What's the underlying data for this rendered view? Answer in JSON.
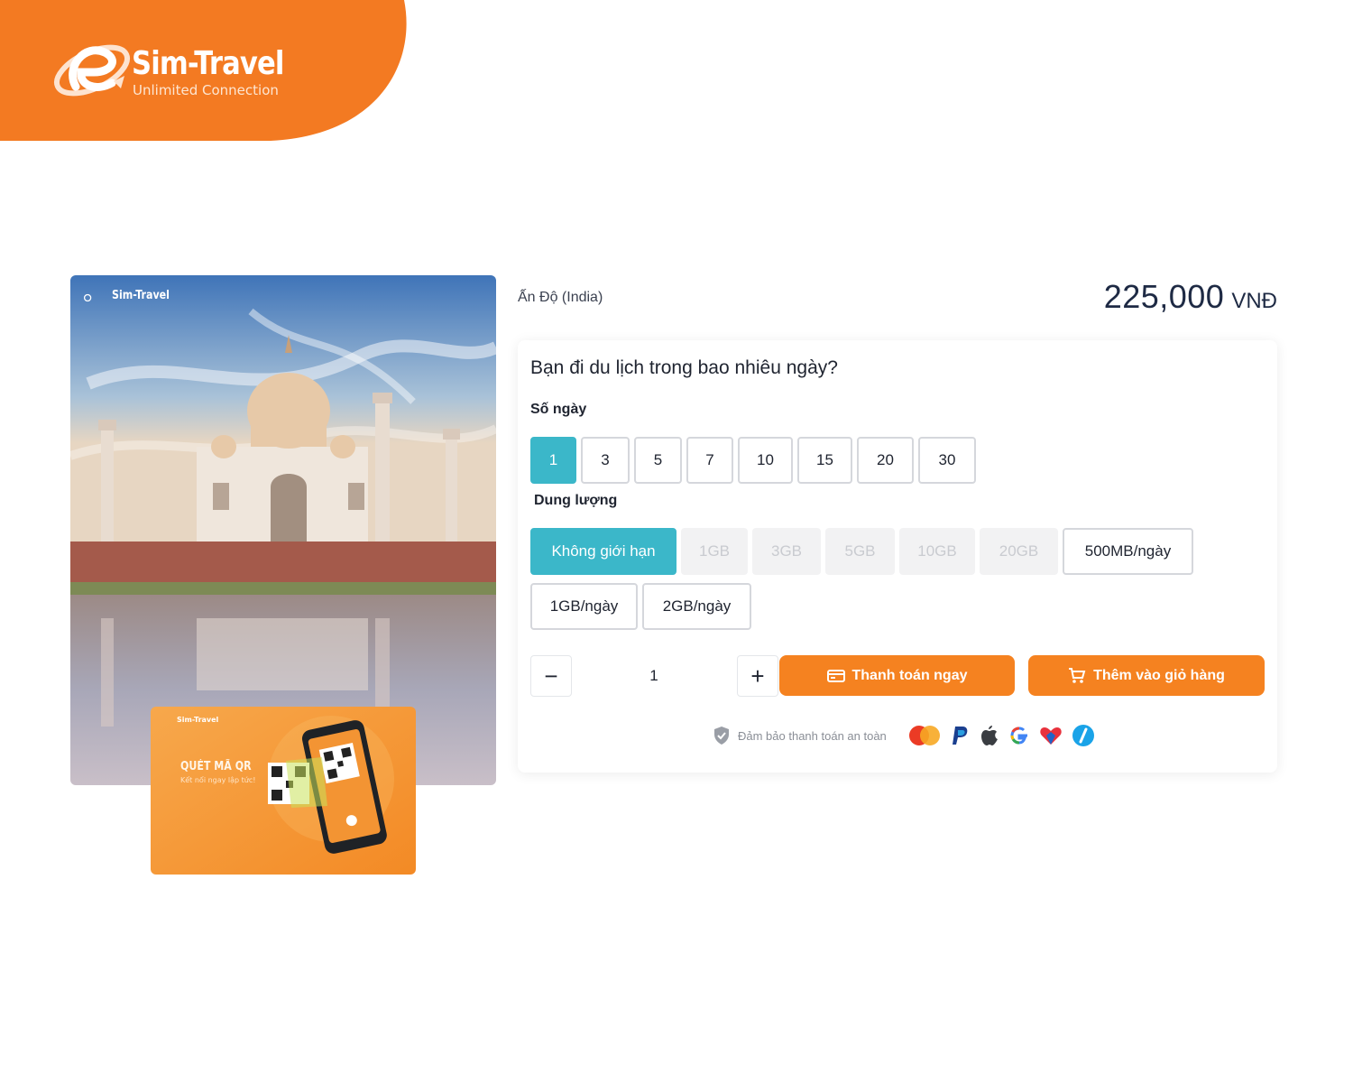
{
  "brand": {
    "name": "Sim-Travel",
    "tagline": "Unlimited Connection",
    "accent_color": "#f58220",
    "teal_color": "#3bb7c9"
  },
  "product": {
    "country": "Ấn Độ (India)",
    "price_amount": "225,000",
    "price_currency": "VNĐ",
    "image_logo": "Sim-Travel",
    "sim_card": {
      "logo": "Sim-Travel",
      "headline": "QUÉT MÃ QR",
      "subline": "Kết nối ngay lập tức!"
    }
  },
  "panel": {
    "question": "Bạn đi du lịch trong bao nhiêu ngày?",
    "days_label": "Số ngày",
    "days": [
      {
        "label": "1",
        "selected": true
      },
      {
        "label": "3",
        "selected": false
      },
      {
        "label": "5",
        "selected": false
      },
      {
        "label": "7",
        "selected": false
      },
      {
        "label": "10",
        "selected": false
      },
      {
        "label": "15",
        "selected": false
      },
      {
        "label": "20",
        "selected": false
      },
      {
        "label": "30",
        "selected": false
      }
    ],
    "data_label": "Dung lượng",
    "data_options": [
      {
        "label": "Không giới hạn",
        "state": "selected"
      },
      {
        "label": "1GB",
        "state": "disabled"
      },
      {
        "label": "3GB",
        "state": "disabled"
      },
      {
        "label": "5GB",
        "state": "disabled"
      },
      {
        "label": "10GB",
        "state": "disabled"
      },
      {
        "label": "20GB",
        "state": "disabled"
      },
      {
        "label": "500MB/ngày",
        "state": "available"
      },
      {
        "label": "1GB/ngày",
        "state": "available"
      },
      {
        "label": "2GB/ngày",
        "state": "available"
      }
    ],
    "quantity": {
      "minus_label": "−",
      "value": "1",
      "plus_label": "+"
    },
    "buy_now_label": "Thanh toán ngay",
    "add_to_cart_label": "Thêm vào giỏ hàng",
    "secure_text": "Đảm bảo thanh toán an toàn",
    "payment_icons": [
      "mastercard-icon",
      "paypal-icon",
      "apple-icon",
      "google-icon",
      "heart-wallet-icon",
      "slash-pay-icon"
    ]
  }
}
